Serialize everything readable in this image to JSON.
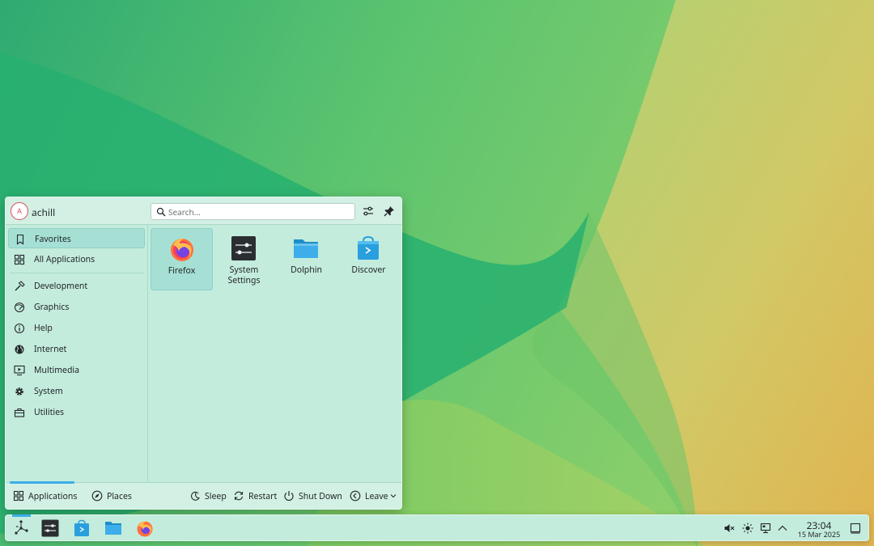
{
  "launcher": {
    "username": "achill",
    "avatar_initial": "A",
    "search_placeholder": "Search...",
    "categories": [
      {
        "label": "Favorites",
        "icon": "bookmark-icon",
        "active": true
      },
      {
        "label": "All Applications",
        "icon": "grid-icon"
      },
      {
        "label": "Development",
        "icon": "hammer-icon"
      },
      {
        "label": "Graphics",
        "icon": "palette-icon"
      },
      {
        "label": "Help",
        "icon": "info-icon"
      },
      {
        "label": "Internet",
        "icon": "globe-icon"
      },
      {
        "label": "Multimedia",
        "icon": "monitor-play-icon"
      },
      {
        "label": "System",
        "icon": "gear-icon"
      },
      {
        "label": "Utilities",
        "icon": "toolbox-icon"
      }
    ],
    "favorites": [
      {
        "label": "Firefox",
        "icon": "firefox-icon",
        "active": true
      },
      {
        "label": "System Settings",
        "label_line1": "System",
        "label_line2": "Settings",
        "icon": "system-settings-icon"
      },
      {
        "label": "Dolphin",
        "icon": "dolphin-folder-icon"
      },
      {
        "label": "Discover",
        "icon": "discover-store-icon"
      }
    ],
    "footer": {
      "applications": "Applications",
      "places": "Places",
      "sleep": "Sleep",
      "restart": "Restart",
      "shutdown": "Shut Down",
      "leave": "Leave"
    }
  },
  "taskbar": {
    "clock_time": "23:04",
    "clock_date": "15 Mar 2025"
  },
  "colors": {
    "accent": "#3daee9",
    "panel_bg": "#c3ecdd",
    "selection": "#a6e0d5"
  }
}
